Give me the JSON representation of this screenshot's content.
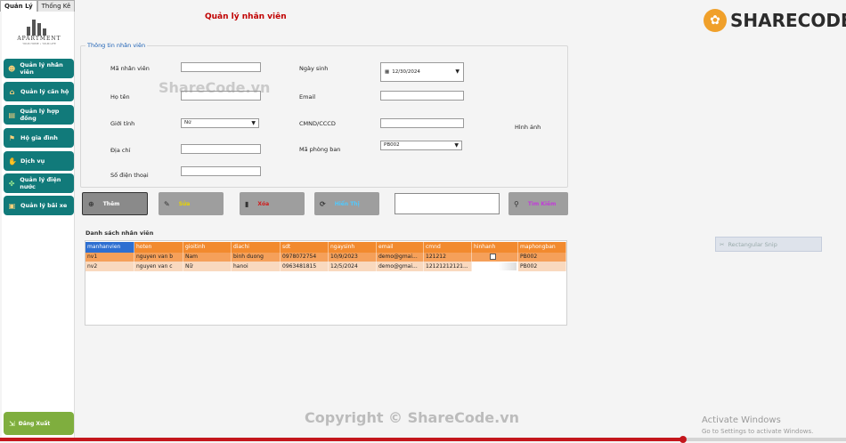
{
  "tabs": [
    "Quản Lý",
    "Thống Kê"
  ],
  "logo": {
    "name": "APARTMENT",
    "tagline": "YOUR HOME • YOUR LIFE"
  },
  "sidebar": {
    "items": [
      {
        "label": "Quản lý nhân viên",
        "icon": "people-icon"
      },
      {
        "label": "Quản lý căn hộ",
        "icon": "house-icon"
      },
      {
        "label": "Quản lý hợp đồng",
        "icon": "contract-icon"
      },
      {
        "label": "Hộ gia đình",
        "icon": "family-icon"
      },
      {
        "label": "Dịch vụ",
        "icon": "service-icon"
      },
      {
        "label": "Quản lý điện nước",
        "icon": "utility-icon"
      },
      {
        "label": "Quản lý bãi xe",
        "icon": "parking-icon"
      }
    ],
    "logout": "Đăng Xuất"
  },
  "page_title": "Quản lý nhân viên",
  "form": {
    "legend": "Thông tin nhân viên",
    "labels": {
      "ma_nv": "Mã nhân viên",
      "ho_ten": "Họ tên",
      "gioi_tinh": "Giới tính",
      "dia_chi": "Địa chỉ",
      "sdt": "Số điện thoại",
      "ngay_sinh": "Ngày sinh",
      "email": "Email",
      "cmnd": "CMND/CCCD",
      "ma_pb": "Mã phòng ban",
      "hinh_anh": "Hình ảnh"
    },
    "values": {
      "ma_nv": "",
      "ho_ten": "",
      "gioi_tinh": "Nữ",
      "dia_chi": "",
      "sdt": "",
      "ngay_sinh": "12/30/2024",
      "email": "",
      "cmnd": "",
      "ma_pb": "PB002"
    }
  },
  "actions": {
    "them": "Thêm",
    "sua": "Sửa",
    "xoa": "Xóa",
    "hien_thi": "Hiển Thị",
    "tim_kiem": "Tìm Kiếm",
    "search_value": ""
  },
  "colors": {
    "nav": "#117a7a",
    "header": "#f28a2e",
    "row1": "#f5a05a",
    "row2": "#f9d9bf",
    "title": "#c00000",
    "sua": "#e8d400",
    "xoa": "#d11a1a",
    "hien_thi": "#4fc9ff",
    "tim_kiem": "#c23bd9"
  },
  "list": {
    "title": "Danh sách nhân viên",
    "columns": [
      "manhanvien",
      "hoten",
      "gioitinh",
      "diachi",
      "sdt",
      "ngaysinh",
      "email",
      "cmnd",
      "hinhanh",
      "maphongban"
    ],
    "rows": [
      [
        "nv1",
        "nguyen van b",
        "Nam",
        "binh duong",
        "0978072754",
        "10/9/2023",
        "demo@gmai...",
        "121212",
        "",
        "PB002"
      ],
      [
        "nv2",
        "nguyen van c",
        "Nữ",
        "hanoi",
        "0963481815",
        "12/5/2024",
        "demo@gmai...",
        "12121212121...",
        "",
        "PB002"
      ]
    ]
  },
  "overlay": {
    "watermark": "ShareCode.vn",
    "brand": "SHARECODE.vn",
    "copyright": "Copyright © ShareCode.vn",
    "ghost_item": "Rectangular Snip",
    "activate_title": "Activate Windows",
    "activate_sub": "Go to Settings to activate Windows.",
    "video_progress": 0.807
  }
}
